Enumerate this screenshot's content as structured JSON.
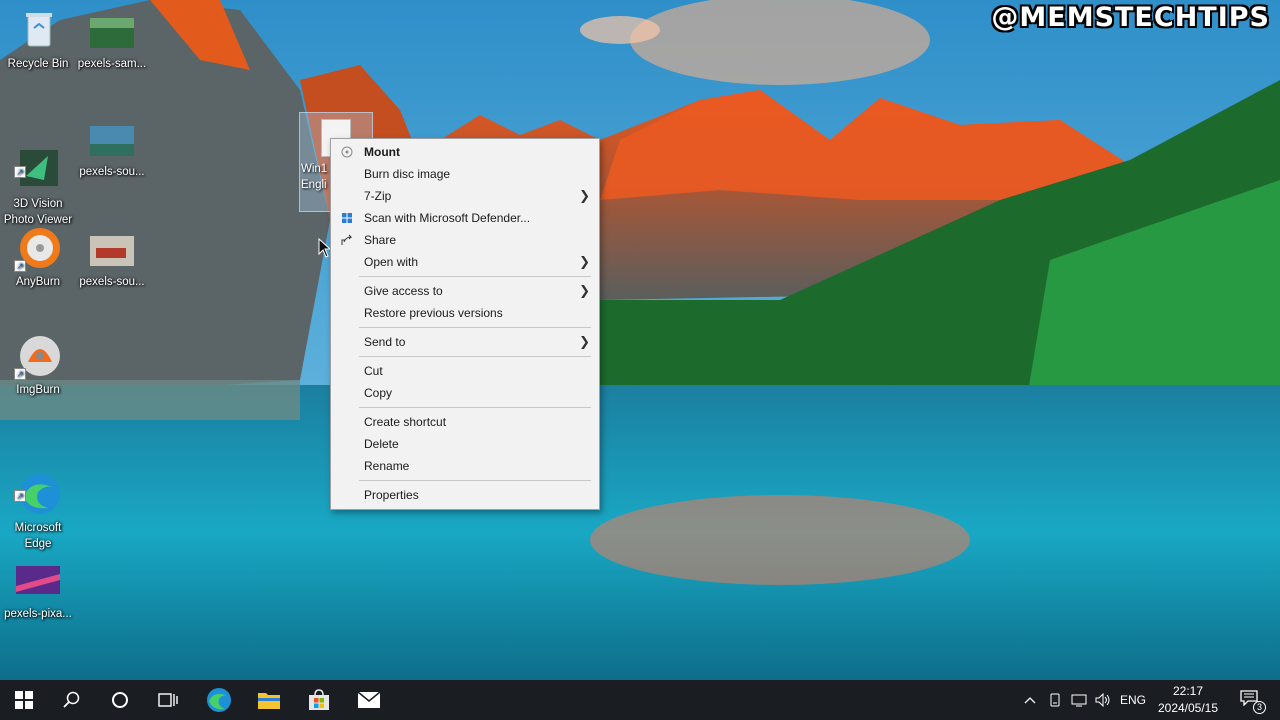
{
  "watermark": "@MEMSTECHTIPS",
  "desktop_icons": [
    {
      "label": "Recycle Bin"
    },
    {
      "label": "pexels-sam..."
    },
    {
      "label": "3D Vision\nPhoto Viewer"
    },
    {
      "label": "pexels-sou..."
    },
    {
      "label": "AnyBurn"
    },
    {
      "label": "pexels-sou..."
    },
    {
      "label": "ImgBurn"
    },
    {
      "label": "Microsoft\nEdge"
    },
    {
      "label": "pexels-pixa..."
    }
  ],
  "selected_file": {
    "label": "Win1\nEngli"
  },
  "context_menu": {
    "items": [
      {
        "label": "Mount",
        "icon": "disc-icon"
      },
      {
        "label": "Burn disc image"
      },
      {
        "label": "7-Zip",
        "submenu": true
      },
      {
        "label": "Scan with Microsoft Defender...",
        "icon": "defender-icon"
      },
      {
        "label": "Share",
        "icon": "share-icon"
      },
      {
        "label": "Open with",
        "submenu": true
      },
      {
        "label": "Give access to",
        "submenu": true
      },
      {
        "label": "Restore previous versions"
      },
      {
        "label": "Send to",
        "submenu": true
      },
      {
        "label": "Cut"
      },
      {
        "label": "Copy"
      },
      {
        "label": "Create shortcut"
      },
      {
        "label": "Delete"
      },
      {
        "label": "Rename"
      },
      {
        "label": "Properties"
      }
    ]
  },
  "taskbar": {
    "language": "ENG",
    "time": "22:17",
    "date": "2024/05/15",
    "notification_count": "3"
  },
  "colors": {
    "taskbar_bg": "#1a1e22",
    "menu_bg": "#f2f2f2",
    "accent": "#0078d7"
  }
}
